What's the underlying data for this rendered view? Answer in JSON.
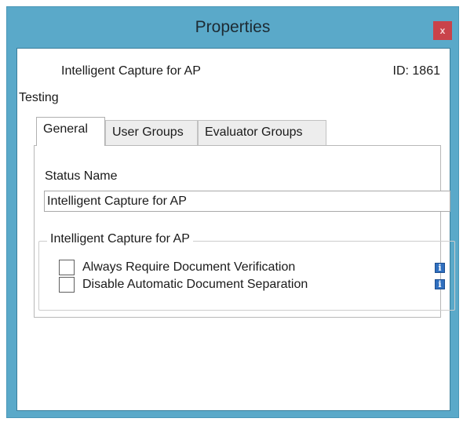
{
  "window": {
    "title": "Properties",
    "close_glyph": "x"
  },
  "header": {
    "name": "Intelligent Capture for AP",
    "id": "ID: 1861"
  },
  "section_label": "Testing",
  "tabs": [
    {
      "label": "General",
      "active": true
    },
    {
      "label": "User Groups",
      "active": false
    },
    {
      "label": "Evaluator Groups",
      "active": false
    }
  ],
  "general": {
    "status_name_label": "Status Name",
    "status_name_value": "Intelligent Capture for AP",
    "group_title": "Intelligent Capture for AP",
    "options": [
      {
        "label": "Always Require Document Verification",
        "checked": false,
        "icon": "info-icon"
      },
      {
        "label": "Disable Automatic Document Separation",
        "checked": false,
        "icon": "info-icon"
      }
    ]
  },
  "colors": {
    "title_bar": "#5aa9c9",
    "close_button": "#c9434a",
    "info_icon": "#2f6fbf"
  }
}
